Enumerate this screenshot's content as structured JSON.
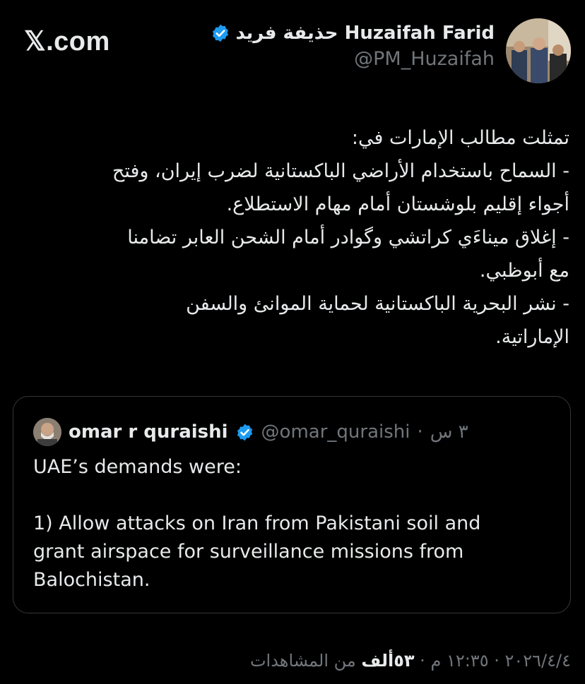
{
  "site": {
    "logo_text": "𝕏.com"
  },
  "author": {
    "name": "حذيفة فريد Huzaifah Farid",
    "handle": "@PM_Huzaifah",
    "verified": true,
    "avatar_icon": "avatar-photo-icon"
  },
  "post": {
    "lines": [
      "تمثلت مطالب الإمارات في:",
      "- السماح باستخدام الأراضي الباكستانية لضرب إيران، وفتح",
      "أجواء إقليم بلوشستان أمام مهام الاستطلاع.",
      "- إغلاق ميناءَي كراتشي وگوادر أمام الشحن العابر تضامنا",
      "مع أبوظبي.",
      "- نشر البحرية الباكستانية لحماية الموانئ والسفن",
      "الإماراتية."
    ]
  },
  "quote": {
    "name": "omar r quraishi",
    "handle": "@omar_quraishi",
    "separator": "·",
    "time": "٣ س",
    "verified": true,
    "text_lines": [
      "UAE’s demands were:",
      "",
      "1) Allow attacks on Iran from Pakistani soil and",
      "grant airspace for surveillance missions from",
      "Balochistan."
    ]
  },
  "footer": {
    "date": "٢٠٢٦/٤/٤",
    "sep1": " · ",
    "time": "١٢:٣٥ م",
    "sep2": " · ",
    "views_count": "٥٣ألف",
    "views_label": " من المشاهدات"
  },
  "colors": {
    "background": "#000000",
    "text_primary": "#e7e9ea",
    "text_secondary": "#71767b",
    "verified_blue": "#1d9bf0",
    "border": "#333639"
  }
}
